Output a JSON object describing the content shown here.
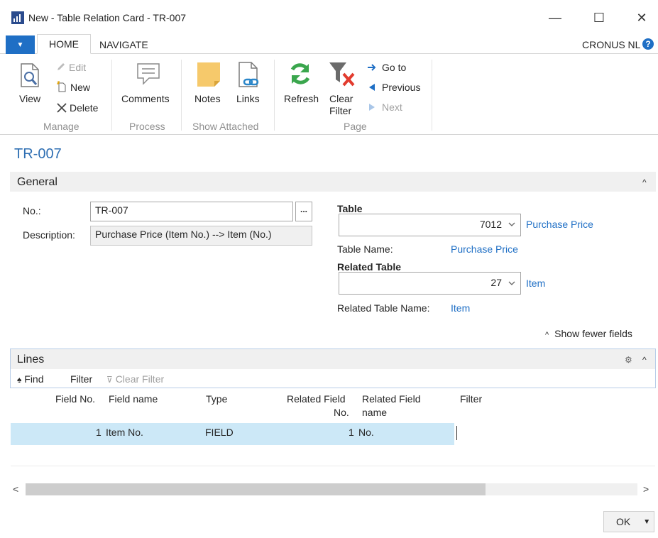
{
  "window": {
    "title": "New - Table Relation Card - TR-007",
    "minimize": "—",
    "maximize": "☐",
    "close": "✕"
  },
  "ribbon": {
    "file_tab": "▼",
    "tabs": [
      {
        "label": "HOME",
        "active": true
      },
      {
        "label": "NAVIGATE",
        "active": false
      }
    ],
    "company": "CRONUS NL",
    "help": "?",
    "groups": {
      "manage": {
        "label": "Manage",
        "view": "View",
        "edit": "Edit",
        "new": "New",
        "delete": "Delete"
      },
      "process": {
        "label": "Process",
        "comments": "Comments"
      },
      "show_attached": {
        "label": "Show Attached",
        "notes": "Notes",
        "links": "Links"
      },
      "page": {
        "label": "Page",
        "refresh": "Refresh",
        "clear_filter_1": "Clear",
        "clear_filter_2": "Filter",
        "go_to": "Go to",
        "previous": "Previous",
        "next": "Next"
      }
    }
  },
  "page": {
    "title": "TR-007"
  },
  "general": {
    "title": "General",
    "no_label": "No.:",
    "no_value": "TR-007",
    "assist_button": "...",
    "description_label": "Description:",
    "description_value": "Purchase Price (Item No.) --> Item (No.)",
    "table_label": "Table",
    "table_value": "7012",
    "table_link": "Purchase Price",
    "table_name_label": "Table Name:",
    "table_name_value": "Purchase Price",
    "related_table_label": "Related Table",
    "related_table_value": "27",
    "related_table_link": "Item",
    "related_table_name_label": "Related Table Name:",
    "related_table_name_value": "Item",
    "show_fewer": "Show fewer fields",
    "chevron": "^"
  },
  "lines": {
    "title": "Lines",
    "toolbar": {
      "find": "Find",
      "filter": "Filter",
      "clear_filter": "Clear Filter"
    },
    "columns": {
      "field_no": "Field No.",
      "field_name": "Field name",
      "type": "Type",
      "related_field_no_1": "Related Field",
      "related_field_no_2": "No.",
      "related_field_name_1": "Related Field",
      "related_field_name_2": "name",
      "filter": "Filter"
    },
    "rows": [
      {
        "field_no": "1",
        "field_name": "Item No.",
        "type": "FIELD",
        "related_field_no": "1",
        "related_field_name": "No.",
        "filter": ""
      }
    ]
  },
  "scrollbar": {
    "left": "<",
    "right": ">"
  },
  "footer": {
    "ok": "OK",
    "ok_arrow": "▼"
  },
  "colors": {
    "accent": "#1f6fc5",
    "selected_row": "#cce8f7",
    "link": "#1f6fc5",
    "fasttab_bg": "#f0f0f0"
  }
}
